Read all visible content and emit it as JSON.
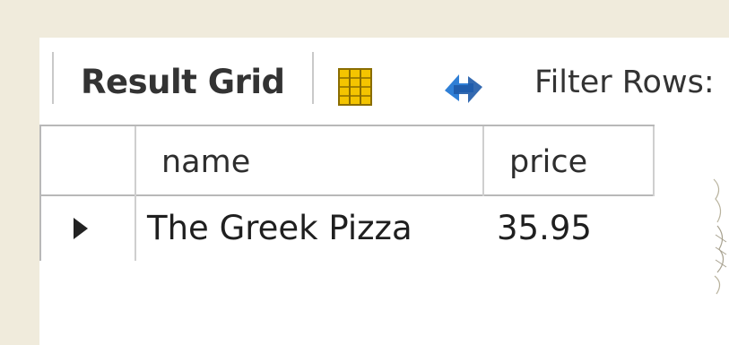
{
  "toolbar": {
    "result_grid_label": "Result Grid",
    "filter_rows_label": "Filter Rows:"
  },
  "icons": {
    "column_toggle": "column-grid-icon",
    "refresh": "refresh-icon"
  },
  "grid": {
    "columns": [
      "name",
      "price"
    ],
    "rows": [
      {
        "name": "The Greek Pizza",
        "price": "35.95"
      }
    ]
  },
  "colors": {
    "background": "#f0ebdc",
    "panel": "#ffffff",
    "icon_yellow": "#f4c400",
    "icon_blue": "#2f7fd6"
  }
}
